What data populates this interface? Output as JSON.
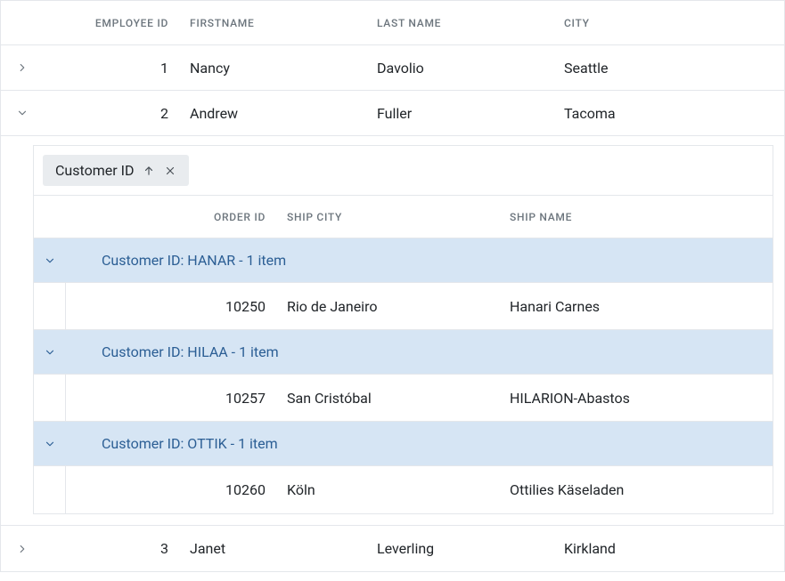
{
  "grid": {
    "columns": {
      "employee_id": "Employee ID",
      "firstname": "FirstName",
      "lastname": "Last Name",
      "city": "City"
    },
    "rows": [
      {
        "expanded": false,
        "employee_id": "1",
        "firstname": "Nancy",
        "lastname": "Davolio",
        "city": "Seattle"
      },
      {
        "expanded": true,
        "employee_id": "2",
        "firstname": "Andrew",
        "lastname": "Fuller",
        "city": "Tacoma"
      },
      {
        "expanded": false,
        "employee_id": "3",
        "firstname": "Janet",
        "lastname": "Leverling",
        "city": "Kirkland"
      }
    ]
  },
  "detail": {
    "group_chip_label": "Customer ID",
    "columns": {
      "order_id": "Order ID",
      "ship_city": "Ship City",
      "ship_name": "Ship Name"
    },
    "groups": [
      {
        "label": "Customer ID: HANAR - 1 item",
        "rows": [
          {
            "order_id": "10250",
            "ship_city": "Rio de Janeiro",
            "ship_name": "Hanari Carnes"
          }
        ]
      },
      {
        "label": "Customer ID: HILAA - 1 item",
        "rows": [
          {
            "order_id": "10257",
            "ship_city": "San Cristóbal",
            "ship_name": "HILARION-Abastos"
          }
        ]
      },
      {
        "label": "Customer ID: OTTIK - 1 item",
        "rows": [
          {
            "order_id": "10260",
            "ship_city": "Köln",
            "ship_name": "Ottilies Käseladen"
          }
        ]
      }
    ]
  }
}
